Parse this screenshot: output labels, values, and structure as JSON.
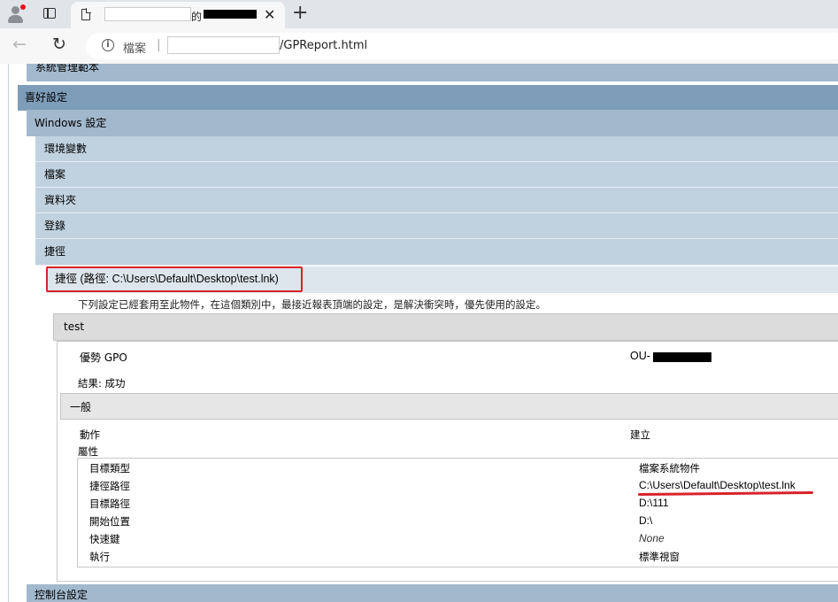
{
  "browser": {
    "tab_title_char": "的",
    "tab_close": "✕",
    "new_tab": "+",
    "url_label": "檔案",
    "url_separator": "|",
    "url_tail": "/GPReport.html",
    "info": "i",
    "back": "←",
    "reload": "↻"
  },
  "report": {
    "sections": {
      "admin_templates": "系統管理範本",
      "preferences": "喜好設定",
      "windows_settings": "Windows 設定",
      "env_vars": "環境變數",
      "files": "檔案",
      "folders": "資料夾",
      "registry": "登錄",
      "shortcuts": "捷徑",
      "shortcut_item": "捷徑 (路徑: C:\\Users\\Default\\Desktop\\test.lnk)",
      "control_panel": "控制台設定"
    },
    "note": "下列設定已經套用至此物件，在這個類別中，最接近報表頂端的設定，是解決衝突時，優先使用的設定。",
    "gpo_name": "test",
    "winning_gpo_label": "優勢 GPO",
    "winning_gpo_value": "OU-",
    "result": "結果: 成功",
    "general": "一般",
    "action_label": "動作",
    "action_value": "建立",
    "properties_label": "屬性",
    "properties": [
      {
        "name": "目標類型",
        "value": "檔案系統物件"
      },
      {
        "name": "捷徑路徑",
        "value": "C:\\Users\\Default\\Desktop\\test.lnk"
      },
      {
        "name": "目標路徑",
        "value": "D:\\111"
      },
      {
        "name": "開始位置",
        "value": "D:\\"
      },
      {
        "name": "快速鍵",
        "value": "None"
      },
      {
        "name": "執行",
        "value": "標準視窗"
      }
    ]
  },
  "colors": {
    "level0": "#7e9db9",
    "level1": "#a2b8cc",
    "level2": "#c0d2e0",
    "level3": "#dde6ed",
    "highlight": "#d8232a"
  }
}
